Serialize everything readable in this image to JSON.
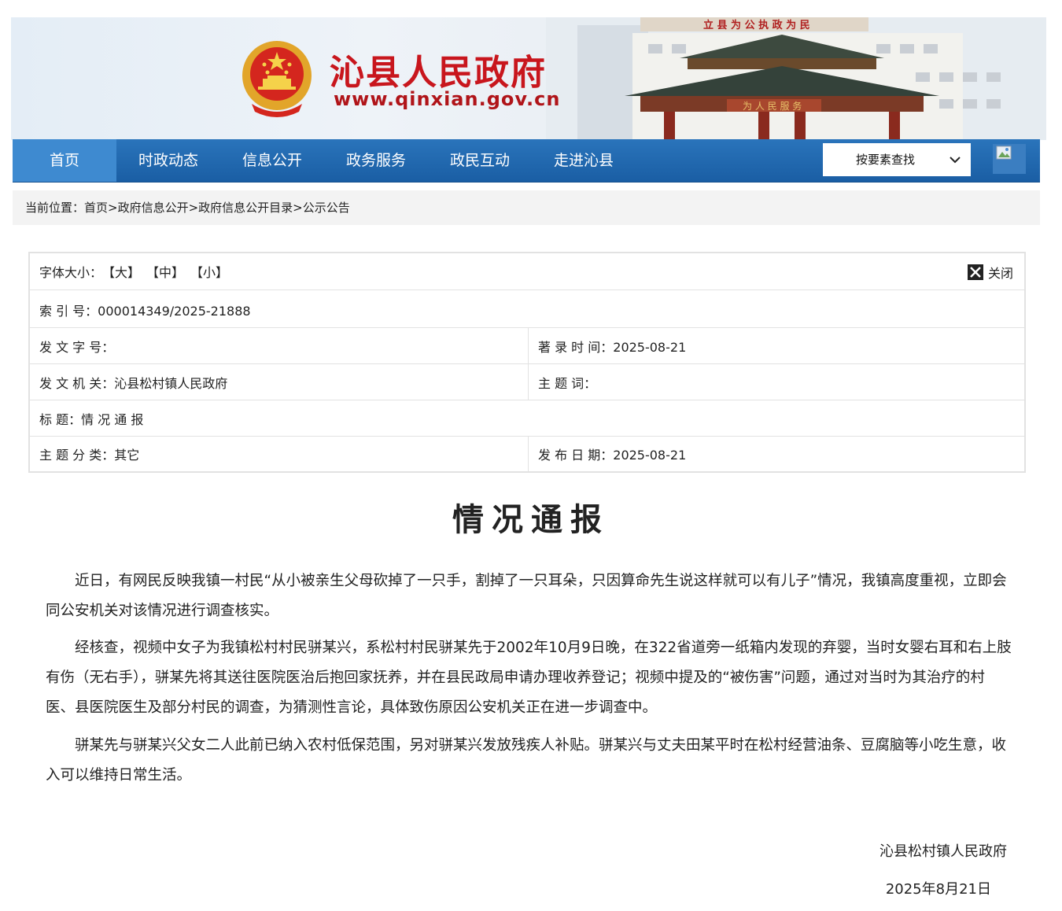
{
  "header": {
    "site_name": "沁县人民政府",
    "site_url": "www.qinxian.gov.cn",
    "building_sign": "立 县 为 公 执 政 为 民"
  },
  "nav": {
    "items": [
      {
        "label": "首页",
        "active": true
      },
      {
        "label": "时政动态"
      },
      {
        "label": "信息公开"
      },
      {
        "label": "政务服务"
      },
      {
        "label": "政民互动"
      },
      {
        "label": "走进沁县"
      }
    ],
    "search_select": "按要素查找",
    "accent": "#1f66ad"
  },
  "breadcrumb": "当前位置：首页>政府信息公开>政府信息公开目录>公示公告",
  "meta": {
    "font_size_label": "字体大小：",
    "font_large": "【大】",
    "font_medium": "【中】",
    "font_small": "【小】",
    "close_label": "关闭",
    "index_no": "索  引  号：000014349/2025-21888",
    "doc_no": "发 文 字 号：",
    "record_time": "著 录 时 间：2025-08-21",
    "issuer": "发 文 机 关：沁县松村镇人民政府",
    "keywords": "主   题   词：",
    "title": "标        题：情 况 通 报",
    "category": "主 题 分 类：其它",
    "publish_date": "发 布 日 期：2025-08-21"
  },
  "document": {
    "title": "情况通报",
    "paragraphs": [
      "近日，有网民反映我镇一村民“从小被亲生父母砍掉了一只手，割掉了一只耳朵，只因算命先生说这样就可以有儿子”情况，我镇高度重视，立即会同公安机关对该情况进行调查核实。",
      "经核查，视频中女子为我镇松村村民骈某兴，系松村村民骈某先于2002年10月9日晚，在322省道旁一纸箱内发现的弃婴，当时女婴右耳和右上肢有伤（无右手），骈某先将其送往医院医治后抱回家抚养，并在县民政局申请办理收养登记；视频中提及的“被伤害”问题，通过对当时为其治疗的村医、县医院医生及部分村民的调查，为猜测性言论，具体致伤原因公安机关正在进一步调查中。",
      "骈某先与骈某兴父女二人此前已纳入农村低保范围，另对骈某兴发放残疾人补贴。骈某兴与丈夫田某平时在松村经营油条、豆腐脑等小吃生意，收入可以维持日常生活。"
    ],
    "signature": "沁县松村镇人民政府",
    "date": "2025年8月21日"
  }
}
